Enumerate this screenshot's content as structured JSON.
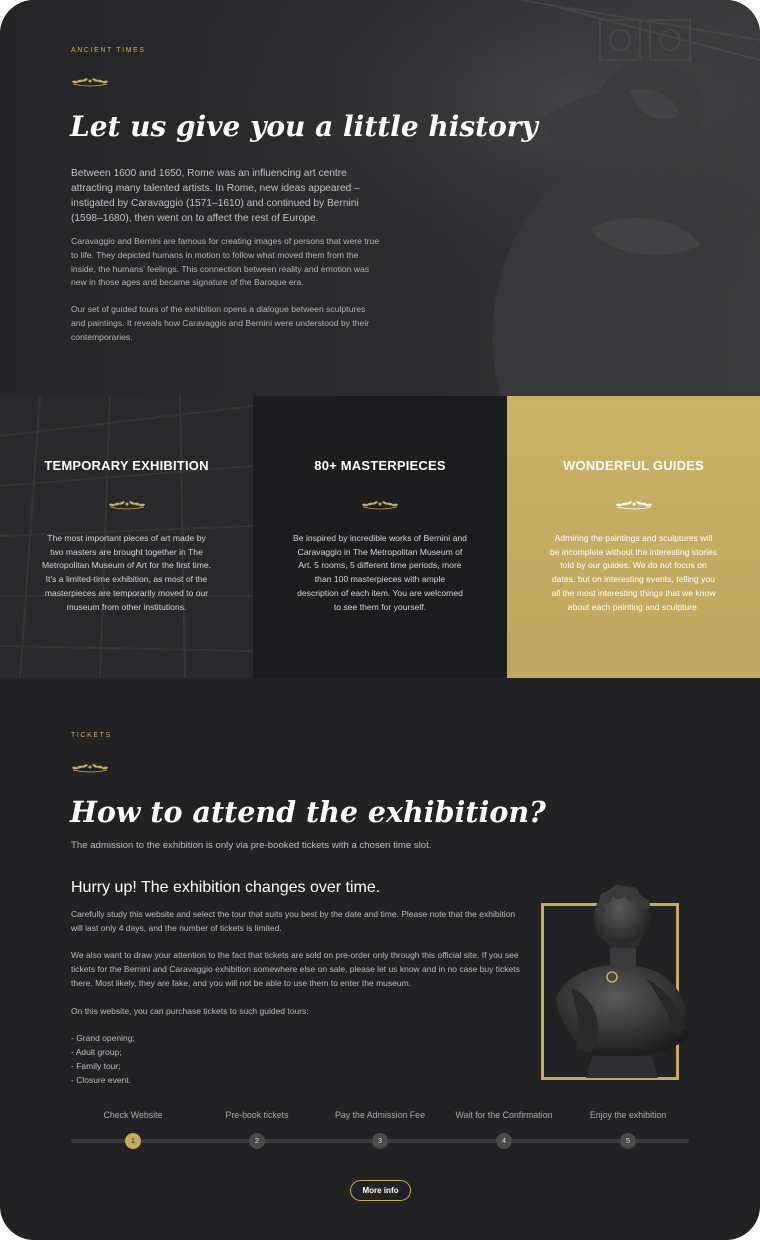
{
  "hero": {
    "kicker": "Ancient times",
    "title": "Let us give you a little history",
    "lead": "Between 1600 and 1650, Rome was an influencing art centre attracting many talented artists. In Rome, new ideas appeared – instigated by Caravaggio (1571–1610) and continued by Bernini (1598–1680), then went on to affect the rest of Europe.",
    "paragraph1": "Caravaggio and Bernini are famous for creating images of persons that were true to life. They depicted humans in motion to follow what moved them from the inside, the humans’ feelings. This connection between reality and emotion was new in those ages and became signature of the Baroque era.",
    "paragraph2": "Our set of guided tours of the exhibition opens a dialogue between sculptures and paintings. It reveals how Caravaggio and Bernini were understood by their contemporaries."
  },
  "features": [
    {
      "title": "TEMPORARY EXHIBITION",
      "text": "The most important pieces of art made by two masters are brought together in The Metropolitan Museum of Art for the first time. It's a limited-time exhibition, as most of the masterpieces are temporarily moved to our museum from other institutions."
    },
    {
      "title": "80+ MASTERPIECES",
      "text": "Be inspired by incredible works of Bernini and Caravaggio in The Metropolitan Museum of Art. 5 rooms, 5 different time periods, more than 100 masterpieces with ample description of each item. You are welcomed to see them for yourself."
    },
    {
      "title": "WONDERFUL GUIDES",
      "text": "Admiring the paintings and sculptures will be incomplete without the interesting stories told by our guides. We do not focus on dates, but on interesting events, telling you all the most interesting things that we know about each painting and sculpture."
    }
  ],
  "tickets": {
    "kicker": "Tickets",
    "title": "How to attend the exhibition?",
    "lead": "The admission to the exhibition is only via pre-booked tickets with a chosen time slot.",
    "subtitle": "Hurry up! The exhibition changes over time.",
    "body": "Carefully study this website and select the tour that suits you best by the date and time. Please note that the exhibition will last only 4 days, and the number of tickets is limited.\n\nWe also want to draw your attention to the fact that tickets are sold on pre-order only through this official site. If you see tickets for the Bernini and Caravaggio exhibition somewhere else on sale, please let us know and in no case buy tickets there. Most likely, they are fake, and you will not be able to use them to enter the museum.\n\nOn this website, you can purchase tickets to such guided tours:\n\n- Grand opening;\n- Adult group;\n- Family tour;\n- Closure event.",
    "steps": [
      {
        "label": "Check Website",
        "num": "1"
      },
      {
        "label": "Pre-book tickets",
        "num": "2"
      },
      {
        "label": "Pay the Admission Fee",
        "num": "3"
      },
      {
        "label": "Wait for the Confirmation",
        "num": "4"
      },
      {
        "label": "Enjoy the exhibition",
        "num": "5"
      }
    ],
    "active_step": 1,
    "button_label": "More info"
  },
  "icons": {
    "laurel": "laurel-icon",
    "bust": "bust-image"
  },
  "colors": {
    "accent_gold": "#c4ab5e",
    "background": "#222224",
    "heading": "#ffffff"
  }
}
